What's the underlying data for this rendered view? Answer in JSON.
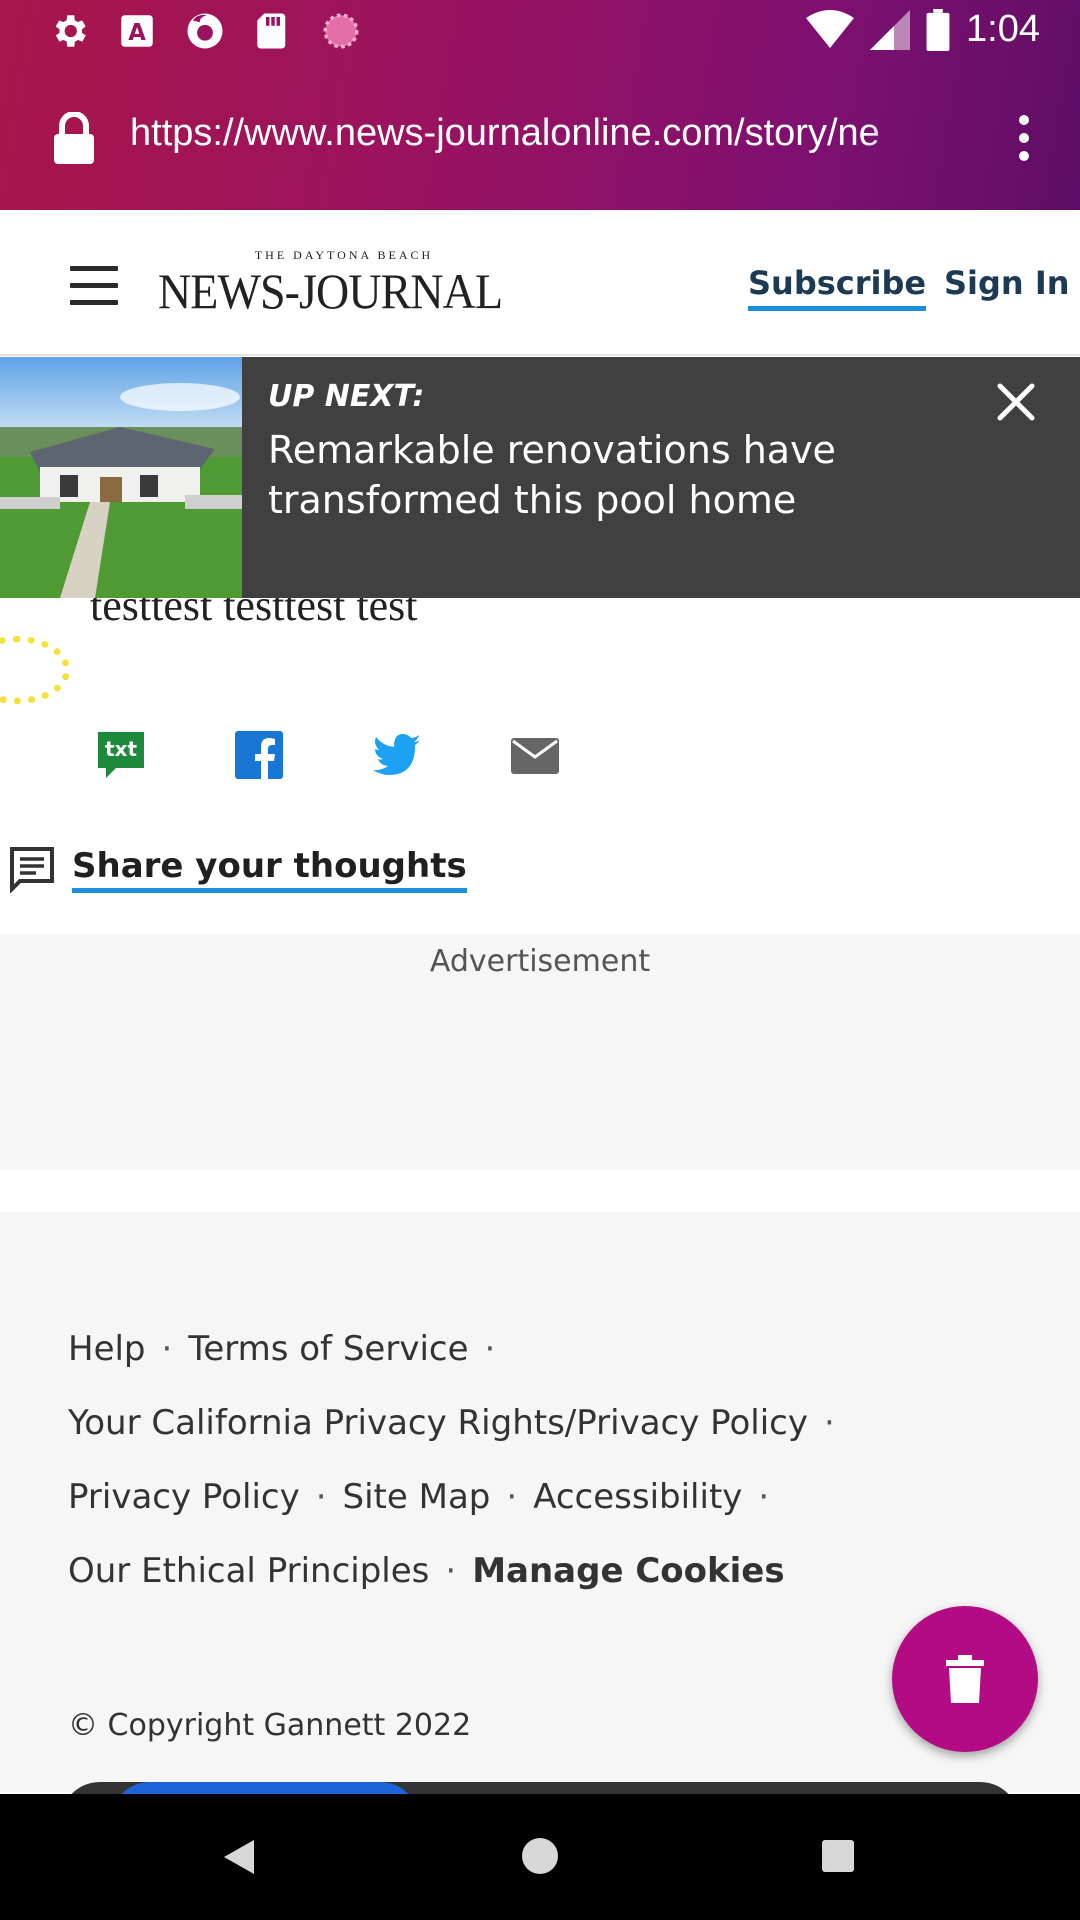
{
  "status_bar": {
    "time": "1:04",
    "left_icons": [
      "gear-icon",
      "app-a-icon",
      "firefox-icon",
      "sd-card-icon",
      "circle-app-icon"
    ],
    "right_icons": [
      "wifi-icon",
      "cell-signal-icon",
      "battery-icon"
    ]
  },
  "browser": {
    "url": "https://www.news-journalonline.com/story/ne"
  },
  "header": {
    "logo_small": "THE DAYTONA BEACH",
    "logo_big": "NEWS-JOURNAL",
    "subscribe_label": "Subscribe",
    "signin_label": "Sign In"
  },
  "up_next": {
    "label": "UP NEXT:",
    "title": "Remarkable renovations have transformed this pool home"
  },
  "article": {
    "text": "testtest testtest test"
  },
  "share": {
    "buttons": [
      "txt",
      "facebook-icon",
      "twitter-icon",
      "email-icon"
    ],
    "txt_label": "txt",
    "comments_label": "Share your thoughts"
  },
  "ad": {
    "label": "Advertisement"
  },
  "footer": {
    "links": {
      "help": "Help",
      "terms": "Terms of Service",
      "ca_privacy": "Your California Privacy Rights/Privacy Policy",
      "privacy": "Privacy Policy",
      "sitemap": "Site Map",
      "accessibility": "Accessibility",
      "ethics": "Our Ethical Principles",
      "cookies": "Manage Cookies"
    },
    "separator": "·",
    "copyright": "© Copyright Gannett 2022"
  },
  "colors": {
    "chrome_gradient_start": "#a8174a",
    "chrome_gradient_end": "#5e0e66",
    "link_underline": "#1b8fd9",
    "fab": "#b30b84",
    "up_next_bg": "#404040"
  }
}
